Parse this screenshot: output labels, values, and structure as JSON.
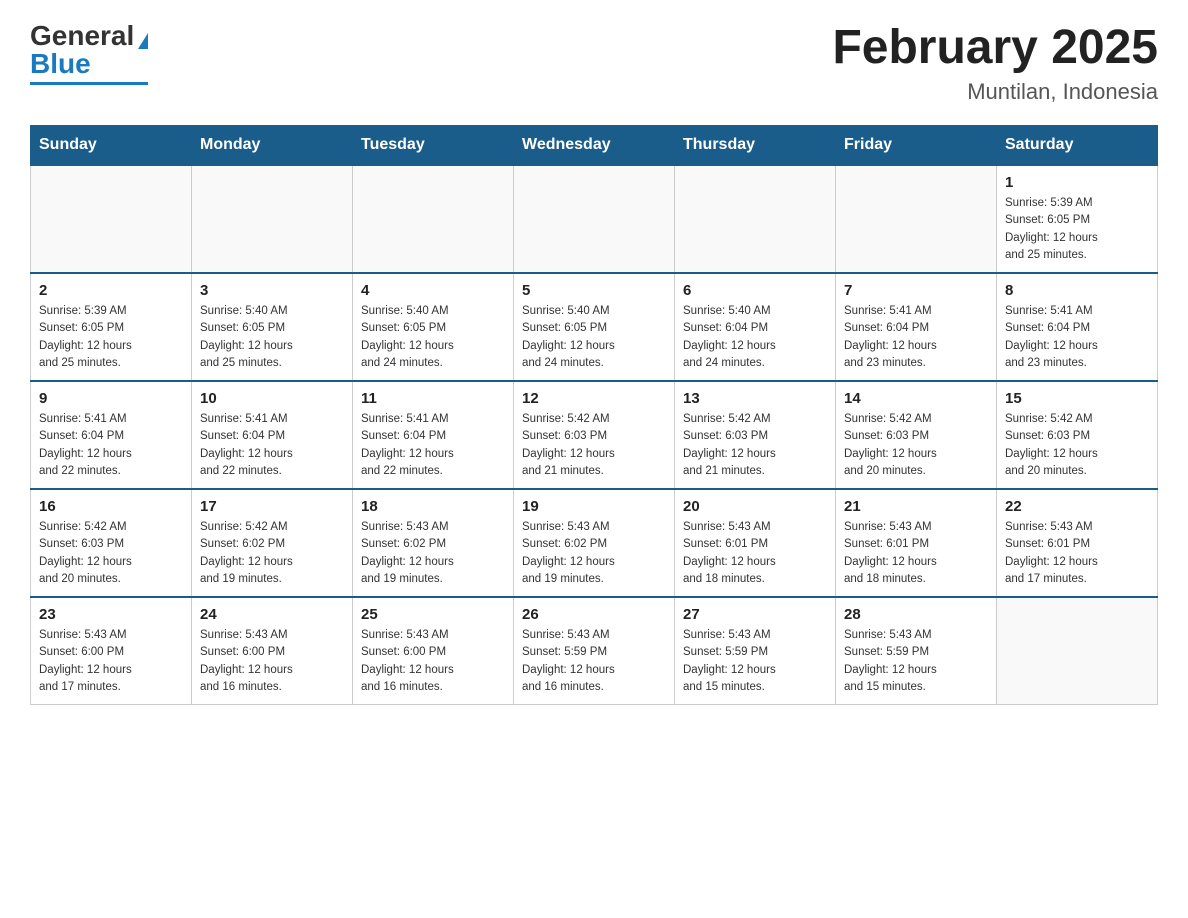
{
  "header": {
    "logo": {
      "general": "General",
      "blue": "Blue"
    },
    "title": "February 2025",
    "location": "Muntilan, Indonesia"
  },
  "weekdays": [
    "Sunday",
    "Monday",
    "Tuesday",
    "Wednesday",
    "Thursday",
    "Friday",
    "Saturday"
  ],
  "weeks": [
    [
      {
        "day": "",
        "info": ""
      },
      {
        "day": "",
        "info": ""
      },
      {
        "day": "",
        "info": ""
      },
      {
        "day": "",
        "info": ""
      },
      {
        "day": "",
        "info": ""
      },
      {
        "day": "",
        "info": ""
      },
      {
        "day": "1",
        "info": "Sunrise: 5:39 AM\nSunset: 6:05 PM\nDaylight: 12 hours\nand 25 minutes."
      }
    ],
    [
      {
        "day": "2",
        "info": "Sunrise: 5:39 AM\nSunset: 6:05 PM\nDaylight: 12 hours\nand 25 minutes."
      },
      {
        "day": "3",
        "info": "Sunrise: 5:40 AM\nSunset: 6:05 PM\nDaylight: 12 hours\nand 25 minutes."
      },
      {
        "day": "4",
        "info": "Sunrise: 5:40 AM\nSunset: 6:05 PM\nDaylight: 12 hours\nand 24 minutes."
      },
      {
        "day": "5",
        "info": "Sunrise: 5:40 AM\nSunset: 6:05 PM\nDaylight: 12 hours\nand 24 minutes."
      },
      {
        "day": "6",
        "info": "Sunrise: 5:40 AM\nSunset: 6:04 PM\nDaylight: 12 hours\nand 24 minutes."
      },
      {
        "day": "7",
        "info": "Sunrise: 5:41 AM\nSunset: 6:04 PM\nDaylight: 12 hours\nand 23 minutes."
      },
      {
        "day": "8",
        "info": "Sunrise: 5:41 AM\nSunset: 6:04 PM\nDaylight: 12 hours\nand 23 minutes."
      }
    ],
    [
      {
        "day": "9",
        "info": "Sunrise: 5:41 AM\nSunset: 6:04 PM\nDaylight: 12 hours\nand 22 minutes."
      },
      {
        "day": "10",
        "info": "Sunrise: 5:41 AM\nSunset: 6:04 PM\nDaylight: 12 hours\nand 22 minutes."
      },
      {
        "day": "11",
        "info": "Sunrise: 5:41 AM\nSunset: 6:04 PM\nDaylight: 12 hours\nand 22 minutes."
      },
      {
        "day": "12",
        "info": "Sunrise: 5:42 AM\nSunset: 6:03 PM\nDaylight: 12 hours\nand 21 minutes."
      },
      {
        "day": "13",
        "info": "Sunrise: 5:42 AM\nSunset: 6:03 PM\nDaylight: 12 hours\nand 21 minutes."
      },
      {
        "day": "14",
        "info": "Sunrise: 5:42 AM\nSunset: 6:03 PM\nDaylight: 12 hours\nand 20 minutes."
      },
      {
        "day": "15",
        "info": "Sunrise: 5:42 AM\nSunset: 6:03 PM\nDaylight: 12 hours\nand 20 minutes."
      }
    ],
    [
      {
        "day": "16",
        "info": "Sunrise: 5:42 AM\nSunset: 6:03 PM\nDaylight: 12 hours\nand 20 minutes."
      },
      {
        "day": "17",
        "info": "Sunrise: 5:42 AM\nSunset: 6:02 PM\nDaylight: 12 hours\nand 19 minutes."
      },
      {
        "day": "18",
        "info": "Sunrise: 5:43 AM\nSunset: 6:02 PM\nDaylight: 12 hours\nand 19 minutes."
      },
      {
        "day": "19",
        "info": "Sunrise: 5:43 AM\nSunset: 6:02 PM\nDaylight: 12 hours\nand 19 minutes."
      },
      {
        "day": "20",
        "info": "Sunrise: 5:43 AM\nSunset: 6:01 PM\nDaylight: 12 hours\nand 18 minutes."
      },
      {
        "day": "21",
        "info": "Sunrise: 5:43 AM\nSunset: 6:01 PM\nDaylight: 12 hours\nand 18 minutes."
      },
      {
        "day": "22",
        "info": "Sunrise: 5:43 AM\nSunset: 6:01 PM\nDaylight: 12 hours\nand 17 minutes."
      }
    ],
    [
      {
        "day": "23",
        "info": "Sunrise: 5:43 AM\nSunset: 6:00 PM\nDaylight: 12 hours\nand 17 minutes."
      },
      {
        "day": "24",
        "info": "Sunrise: 5:43 AM\nSunset: 6:00 PM\nDaylight: 12 hours\nand 16 minutes."
      },
      {
        "day": "25",
        "info": "Sunrise: 5:43 AM\nSunset: 6:00 PM\nDaylight: 12 hours\nand 16 minutes."
      },
      {
        "day": "26",
        "info": "Sunrise: 5:43 AM\nSunset: 5:59 PM\nDaylight: 12 hours\nand 16 minutes."
      },
      {
        "day": "27",
        "info": "Sunrise: 5:43 AM\nSunset: 5:59 PM\nDaylight: 12 hours\nand 15 minutes."
      },
      {
        "day": "28",
        "info": "Sunrise: 5:43 AM\nSunset: 5:59 PM\nDaylight: 12 hours\nand 15 minutes."
      },
      {
        "day": "",
        "info": ""
      }
    ]
  ]
}
